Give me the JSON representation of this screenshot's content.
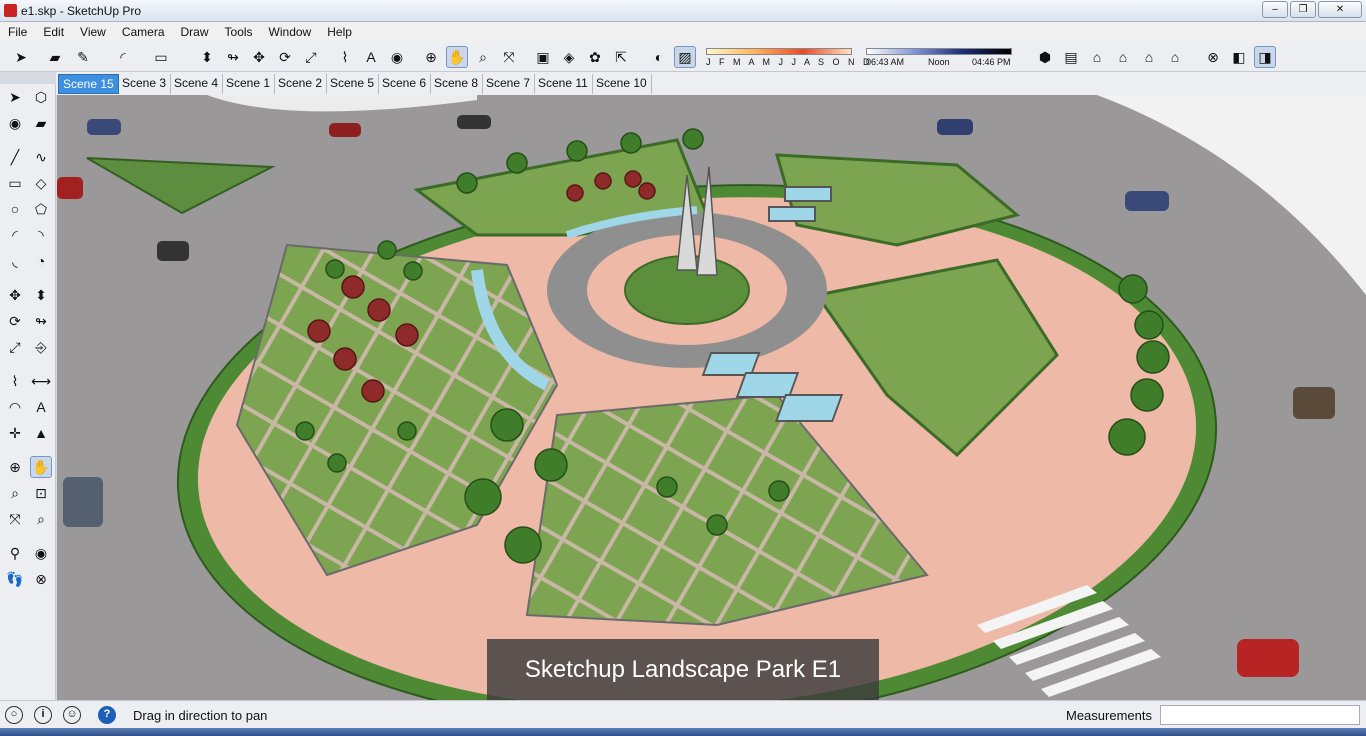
{
  "window": {
    "title": "e1.skp - SketchUp Pro",
    "controls": [
      "–",
      "❐",
      "✕"
    ]
  },
  "menu": [
    "File",
    "Edit",
    "View",
    "Camera",
    "Draw",
    "Tools",
    "Window",
    "Help"
  ],
  "shadow": {
    "months": "J F M A M J J A S O N D",
    "time_start": "06:43 AM",
    "time_mid": "Noon",
    "time_end": "04:46 PM"
  },
  "scenes": {
    "active": "Scene 15",
    "tabs": [
      "Scene 15",
      "Scene 3",
      "Scene 4",
      "Scene 1",
      "Scene 2",
      "Scene 5",
      "Scene 6",
      "Scene 8",
      "Scene 7",
      "Scene 11",
      "Scene 10"
    ]
  },
  "viewport": {
    "caption": "Sketchup Landscape Park E1"
  },
  "status": {
    "message": "Drag in direction to pan",
    "measurements_label": "Measurements",
    "measurements_value": ""
  },
  "colors": {
    "ground": "#9a9898",
    "paving": "#efb9a8",
    "lawn": "#7da451",
    "hedge": "#4d8a33",
    "tree": "#3f7d2b",
    "red_tree": "#8e2a2a",
    "water": "#9fd6e8"
  }
}
